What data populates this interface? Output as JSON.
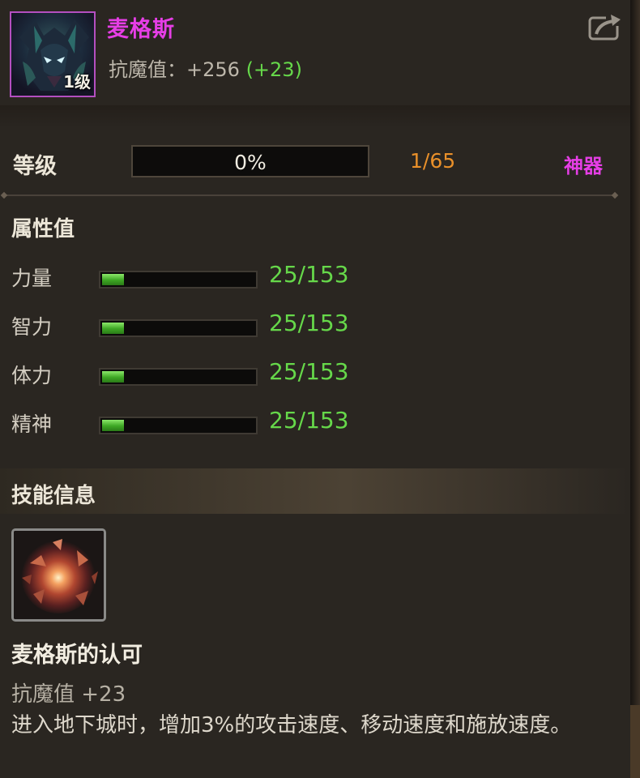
{
  "header": {
    "name": "麦格斯",
    "level_badge": "1级",
    "resist_label": "抗魔值：",
    "resist_value": "+256",
    "resist_bonus": "(+23)"
  },
  "level": {
    "label": "等级",
    "progress_text": "0%",
    "progress_fraction": 0.0,
    "count": "1/65",
    "grade": "神器"
  },
  "attributes": {
    "title": "属性值",
    "items": [
      {
        "label": "力量",
        "value": "25/153",
        "fraction": 0.163
      },
      {
        "label": "智力",
        "value": "25/153",
        "fraction": 0.163
      },
      {
        "label": "体力",
        "value": "25/153",
        "fraction": 0.163
      },
      {
        "label": "精神",
        "value": "25/153",
        "fraction": 0.163
      }
    ]
  },
  "skill": {
    "title": "技能信息",
    "name": "麦格斯的认可",
    "stat": "抗魔值 +23",
    "description": "进入地下城时，增加3%的攻击速度、移动速度和施放速度。"
  },
  "colors": {
    "rarity": "#e63ee6",
    "bonus_green": "#66d84a",
    "level_orange": "#e9902a"
  },
  "icons": {
    "share": "share-icon",
    "portrait": "pet-portrait",
    "skill": "skill-explosion-icon"
  }
}
